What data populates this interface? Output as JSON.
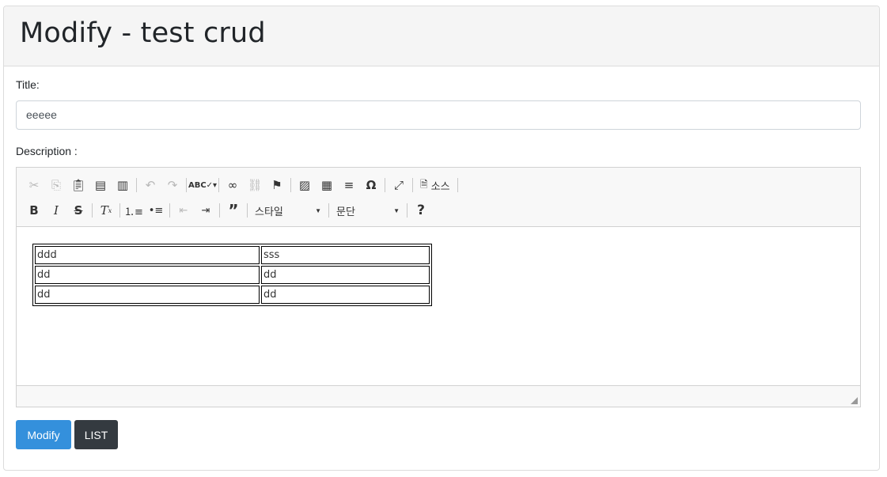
{
  "page": {
    "title": "Modify - test crud"
  },
  "form": {
    "title_label": "Title:",
    "title_value": "eeeee",
    "description_label": "Description :"
  },
  "editor": {
    "toolbar": {
      "source_label": "소스",
      "style_combo": "스타일",
      "format_combo": "문단",
      "icons": [
        "cut-icon",
        "copy-icon",
        "paste-icon",
        "paste-text-icon",
        "paste-word-icon",
        "undo-icon",
        "redo-icon",
        "spellcheck-icon",
        "link-icon",
        "unlink-icon",
        "anchor-icon",
        "image-icon",
        "table-icon",
        "horizontal-rule-icon",
        "special-char-icon",
        "maximize-icon",
        "source-icon",
        "bold-icon",
        "italic-icon",
        "strike-icon",
        "remove-format-icon",
        "numbered-list-icon",
        "bulleted-list-icon",
        "outdent-icon",
        "indent-icon",
        "blockquote-icon",
        "help-icon"
      ]
    },
    "table": [
      [
        "ddd",
        "sss"
      ],
      [
        "dd",
        "dd"
      ],
      [
        "dd",
        "dd"
      ]
    ]
  },
  "buttons": {
    "modify": "Modify",
    "list": "LIST"
  },
  "colors": {
    "primary": "#3490dc",
    "dark": "#343a40"
  }
}
